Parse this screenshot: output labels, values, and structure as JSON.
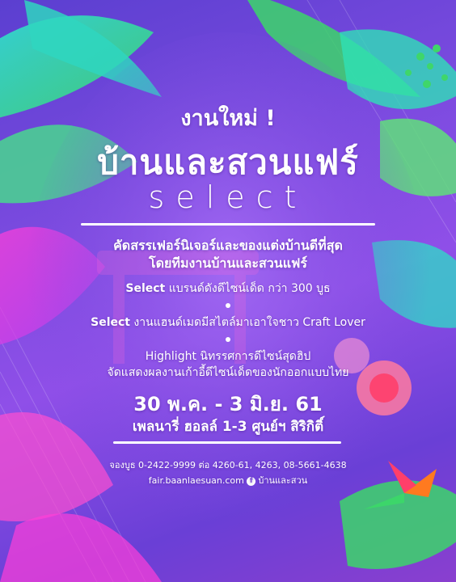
{
  "colors": {
    "background": "#7d4be0",
    "leaf_green": "#3cd66a",
    "leaf_cyan": "#2fe0d6",
    "leaf_pink": "#ff3fd8",
    "hibiscus": "#ff5a7a",
    "bird_of_paradise": "#ff7a1f"
  },
  "header": {
    "tagline": "งานใหม่ !",
    "event_name": "บ้านและสวนแฟร์",
    "edition": "select"
  },
  "intro": {
    "line1": "คัดสรรเฟอร์นิเจอร์และของแต่งบ้านดีที่สุด",
    "line2": "โดยทีมงานบ้านและสวนแฟร์"
  },
  "features": [
    {
      "keyword": "Select",
      "text": " แบรนด์ดังดีไซน์เด็ด กว่า 300 บูธ"
    },
    {
      "keyword": "Select",
      "text": " งานแฮนด์เมดมีสไตล์มาเอาใจชาว Craft Lover"
    },
    {
      "keyword": "Highlight",
      "text": " นิทรรศการดีไซน์สุดฮิป",
      "line2": "จัดแสดงผลงานเก้าอี้ดีไซน์เด็ดของนักออกแบบไทย"
    }
  ],
  "event": {
    "dates": "30 พ.ค. - 3 มิ.ย. 61",
    "venue": "เพลนารี่ ฮอลล์ 1-3 ศูนย์ฯ สิริกิติ์"
  },
  "contact": {
    "booking": "จองบูธ 0-2422-9999 ต่อ 4260-61, 4263, 08-5661-4638",
    "website": "fair.baanlaesuan.com",
    "facebook_icon": "f",
    "facebook": "บ้านและสวน"
  }
}
